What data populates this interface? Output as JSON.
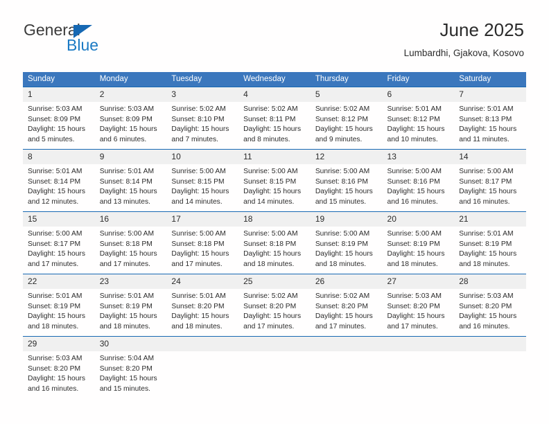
{
  "brand": {
    "name_top": "General",
    "name_bottom": "Blue",
    "triangle_color": "#1668b3",
    "blue_text_color": "#1b7ac4"
  },
  "header": {
    "title": "June 2025",
    "subtitle": "Lumbardhi, Gjakova, Kosovo"
  },
  "theme": {
    "header_bg": "#3b77bd",
    "row_border": "#1668b3",
    "daynum_bg": "#f0f0f0",
    "text": "#2b2b2b"
  },
  "weekdays": [
    "Sunday",
    "Monday",
    "Tuesday",
    "Wednesday",
    "Thursday",
    "Friday",
    "Saturday"
  ],
  "weeks": [
    [
      {
        "day": "1",
        "sunrise": "Sunrise: 5:03 AM",
        "sunset": "Sunset: 8:09 PM",
        "daylight1": "Daylight: 15 hours",
        "daylight2": "and 5 minutes."
      },
      {
        "day": "2",
        "sunrise": "Sunrise: 5:03 AM",
        "sunset": "Sunset: 8:09 PM",
        "daylight1": "Daylight: 15 hours",
        "daylight2": "and 6 minutes."
      },
      {
        "day": "3",
        "sunrise": "Sunrise: 5:02 AM",
        "sunset": "Sunset: 8:10 PM",
        "daylight1": "Daylight: 15 hours",
        "daylight2": "and 7 minutes."
      },
      {
        "day": "4",
        "sunrise": "Sunrise: 5:02 AM",
        "sunset": "Sunset: 8:11 PM",
        "daylight1": "Daylight: 15 hours",
        "daylight2": "and 8 minutes."
      },
      {
        "day": "5",
        "sunrise": "Sunrise: 5:02 AM",
        "sunset": "Sunset: 8:12 PM",
        "daylight1": "Daylight: 15 hours",
        "daylight2": "and 9 minutes."
      },
      {
        "day": "6",
        "sunrise": "Sunrise: 5:01 AM",
        "sunset": "Sunset: 8:12 PM",
        "daylight1": "Daylight: 15 hours",
        "daylight2": "and 10 minutes."
      },
      {
        "day": "7",
        "sunrise": "Sunrise: 5:01 AM",
        "sunset": "Sunset: 8:13 PM",
        "daylight1": "Daylight: 15 hours",
        "daylight2": "and 11 minutes."
      }
    ],
    [
      {
        "day": "8",
        "sunrise": "Sunrise: 5:01 AM",
        "sunset": "Sunset: 8:14 PM",
        "daylight1": "Daylight: 15 hours",
        "daylight2": "and 12 minutes."
      },
      {
        "day": "9",
        "sunrise": "Sunrise: 5:01 AM",
        "sunset": "Sunset: 8:14 PM",
        "daylight1": "Daylight: 15 hours",
        "daylight2": "and 13 minutes."
      },
      {
        "day": "10",
        "sunrise": "Sunrise: 5:00 AM",
        "sunset": "Sunset: 8:15 PM",
        "daylight1": "Daylight: 15 hours",
        "daylight2": "and 14 minutes."
      },
      {
        "day": "11",
        "sunrise": "Sunrise: 5:00 AM",
        "sunset": "Sunset: 8:15 PM",
        "daylight1": "Daylight: 15 hours",
        "daylight2": "and 14 minutes."
      },
      {
        "day": "12",
        "sunrise": "Sunrise: 5:00 AM",
        "sunset": "Sunset: 8:16 PM",
        "daylight1": "Daylight: 15 hours",
        "daylight2": "and 15 minutes."
      },
      {
        "day": "13",
        "sunrise": "Sunrise: 5:00 AM",
        "sunset": "Sunset: 8:16 PM",
        "daylight1": "Daylight: 15 hours",
        "daylight2": "and 16 minutes."
      },
      {
        "day": "14",
        "sunrise": "Sunrise: 5:00 AM",
        "sunset": "Sunset: 8:17 PM",
        "daylight1": "Daylight: 15 hours",
        "daylight2": "and 16 minutes."
      }
    ],
    [
      {
        "day": "15",
        "sunrise": "Sunrise: 5:00 AM",
        "sunset": "Sunset: 8:17 PM",
        "daylight1": "Daylight: 15 hours",
        "daylight2": "and 17 minutes."
      },
      {
        "day": "16",
        "sunrise": "Sunrise: 5:00 AM",
        "sunset": "Sunset: 8:18 PM",
        "daylight1": "Daylight: 15 hours",
        "daylight2": "and 17 minutes."
      },
      {
        "day": "17",
        "sunrise": "Sunrise: 5:00 AM",
        "sunset": "Sunset: 8:18 PM",
        "daylight1": "Daylight: 15 hours",
        "daylight2": "and 17 minutes."
      },
      {
        "day": "18",
        "sunrise": "Sunrise: 5:00 AM",
        "sunset": "Sunset: 8:18 PM",
        "daylight1": "Daylight: 15 hours",
        "daylight2": "and 18 minutes."
      },
      {
        "day": "19",
        "sunrise": "Sunrise: 5:00 AM",
        "sunset": "Sunset: 8:19 PM",
        "daylight1": "Daylight: 15 hours",
        "daylight2": "and 18 minutes."
      },
      {
        "day": "20",
        "sunrise": "Sunrise: 5:00 AM",
        "sunset": "Sunset: 8:19 PM",
        "daylight1": "Daylight: 15 hours",
        "daylight2": "and 18 minutes."
      },
      {
        "day": "21",
        "sunrise": "Sunrise: 5:01 AM",
        "sunset": "Sunset: 8:19 PM",
        "daylight1": "Daylight: 15 hours",
        "daylight2": "and 18 minutes."
      }
    ],
    [
      {
        "day": "22",
        "sunrise": "Sunrise: 5:01 AM",
        "sunset": "Sunset: 8:19 PM",
        "daylight1": "Daylight: 15 hours",
        "daylight2": "and 18 minutes."
      },
      {
        "day": "23",
        "sunrise": "Sunrise: 5:01 AM",
        "sunset": "Sunset: 8:19 PM",
        "daylight1": "Daylight: 15 hours",
        "daylight2": "and 18 minutes."
      },
      {
        "day": "24",
        "sunrise": "Sunrise: 5:01 AM",
        "sunset": "Sunset: 8:20 PM",
        "daylight1": "Daylight: 15 hours",
        "daylight2": "and 18 minutes."
      },
      {
        "day": "25",
        "sunrise": "Sunrise: 5:02 AM",
        "sunset": "Sunset: 8:20 PM",
        "daylight1": "Daylight: 15 hours",
        "daylight2": "and 17 minutes."
      },
      {
        "day": "26",
        "sunrise": "Sunrise: 5:02 AM",
        "sunset": "Sunset: 8:20 PM",
        "daylight1": "Daylight: 15 hours",
        "daylight2": "and 17 minutes."
      },
      {
        "day": "27",
        "sunrise": "Sunrise: 5:03 AM",
        "sunset": "Sunset: 8:20 PM",
        "daylight1": "Daylight: 15 hours",
        "daylight2": "and 17 minutes."
      },
      {
        "day": "28",
        "sunrise": "Sunrise: 5:03 AM",
        "sunset": "Sunset: 8:20 PM",
        "daylight1": "Daylight: 15 hours",
        "daylight2": "and 16 minutes."
      }
    ],
    [
      {
        "day": "29",
        "sunrise": "Sunrise: 5:03 AM",
        "sunset": "Sunset: 8:20 PM",
        "daylight1": "Daylight: 15 hours",
        "daylight2": "and 16 minutes."
      },
      {
        "day": "30",
        "sunrise": "Sunrise: 5:04 AM",
        "sunset": "Sunset: 8:20 PM",
        "daylight1": "Daylight: 15 hours",
        "daylight2": "and 15 minutes."
      },
      {
        "day": "",
        "sunrise": "",
        "sunset": "",
        "daylight1": "",
        "daylight2": ""
      },
      {
        "day": "",
        "sunrise": "",
        "sunset": "",
        "daylight1": "",
        "daylight2": ""
      },
      {
        "day": "",
        "sunrise": "",
        "sunset": "",
        "daylight1": "",
        "daylight2": ""
      },
      {
        "day": "",
        "sunrise": "",
        "sunset": "",
        "daylight1": "",
        "daylight2": ""
      },
      {
        "day": "",
        "sunrise": "",
        "sunset": "",
        "daylight1": "",
        "daylight2": ""
      }
    ]
  ]
}
